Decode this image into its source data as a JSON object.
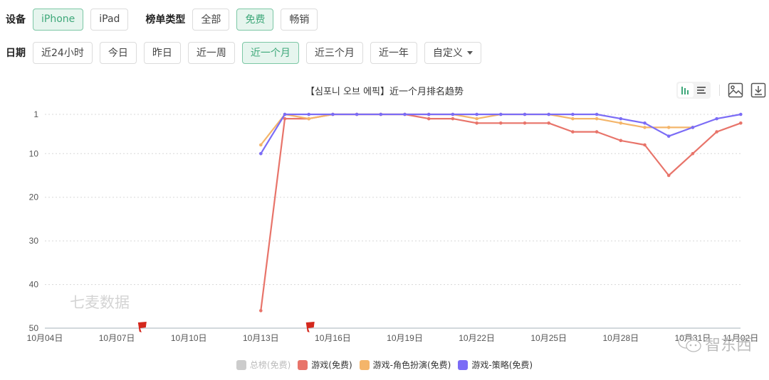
{
  "filters": {
    "device": {
      "label": "设备",
      "options": [
        "iPhone",
        "iPad"
      ],
      "selected": "iPhone"
    },
    "list_type": {
      "label": "榜单类型",
      "options": [
        "全部",
        "免费",
        "畅销"
      ],
      "selected": "免费"
    },
    "date": {
      "label": "日期",
      "options": [
        "近24小时",
        "今日",
        "昨日",
        "近一周",
        "近一个月",
        "近三个月",
        "近一年"
      ],
      "selected": "近一个月",
      "custom_label": "自定义"
    }
  },
  "toolbar": {
    "icons": [
      "bar-chart-icon",
      "list-icon",
      "image-icon",
      "download-icon"
    ]
  },
  "watermark": "七麦数据",
  "corner_watermark": "智东西",
  "chart_data": {
    "type": "line",
    "title": "【심포니 오브 에픽】近一个月排名趋势",
    "xlabel": "",
    "ylabel": "",
    "y_inverted": true,
    "ylim": [
      1,
      50
    ],
    "yticks": [
      1,
      10,
      20,
      30,
      40,
      50
    ],
    "x_tick_labels": [
      "10月04日",
      "10月07日",
      "10月10日",
      "10月13日",
      "10月16日",
      "10月19日",
      "10月22日",
      "10月25日",
      "10月28日",
      "10月31日",
      "11月02日"
    ],
    "x_range_days": [
      "10月04日",
      "11月02日"
    ],
    "x": [
      "10月13日",
      "10月14日",
      "10月15日",
      "10月16日",
      "10月17日",
      "10月18日",
      "10月19日",
      "10月20日",
      "10月21日",
      "10月22日",
      "10月23日",
      "10月24日",
      "10月25日",
      "10月26日",
      "10月27日",
      "10月28日",
      "10月29日",
      "10月30日",
      "10月31日",
      "11月01日",
      "11月02日"
    ],
    "grid": true,
    "legend_position": "bottom",
    "flags": [
      "10月08日",
      "10月15日"
    ],
    "series": [
      {
        "name": "总榜(免费)",
        "color": "#cccccc",
        "visible": false,
        "values": []
      },
      {
        "name": "游戏(免费)",
        "color": "#e8746a",
        "visible": true,
        "values": [
          46,
          2,
          2,
          1,
          1,
          1,
          1,
          2,
          2,
          3,
          3,
          3,
          3,
          5,
          5,
          7,
          8,
          15,
          10,
          5,
          3
        ]
      },
      {
        "name": "游戏-角色扮演(免费)",
        "color": "#f4b56a",
        "visible": true,
        "values": [
          8,
          1,
          2,
          1,
          1,
          1,
          1,
          1,
          1,
          2,
          1,
          1,
          1,
          2,
          2,
          3,
          4,
          4,
          4,
          null,
          null
        ]
      },
      {
        "name": "游戏-策略(免费)",
        "color": "#7b6cf6",
        "visible": true,
        "values": [
          10,
          1,
          1,
          1,
          1,
          1,
          1,
          1,
          1,
          1,
          1,
          1,
          1,
          1,
          1,
          2,
          3,
          6,
          4,
          2,
          1
        ]
      }
    ]
  }
}
